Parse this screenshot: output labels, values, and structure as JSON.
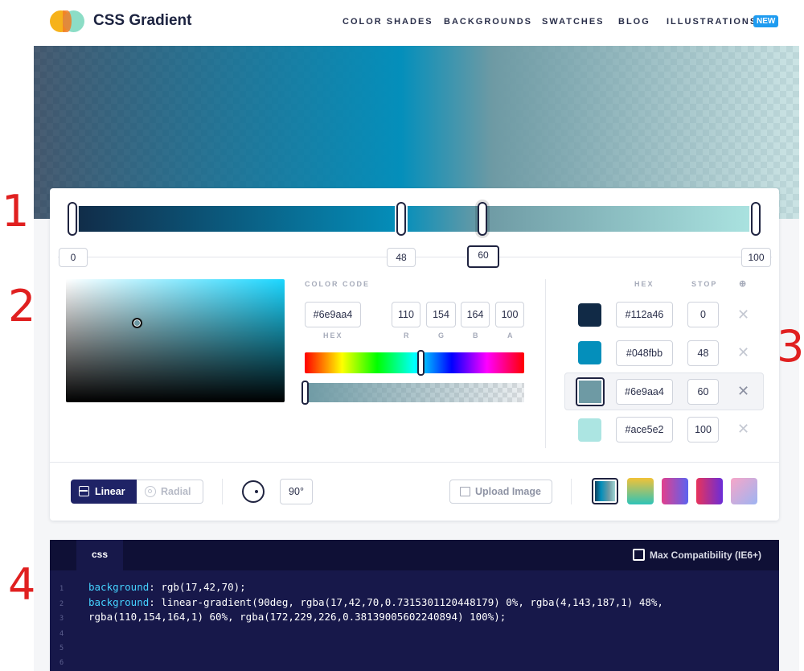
{
  "header": {
    "brand": "CSS Gradient",
    "nav": [
      "COLOR SHADES",
      "BACKGROUNDS",
      "SWATCHES",
      "BLOG",
      "ILLUSTRATIONS"
    ],
    "new_badge": "NEW"
  },
  "gradient_bar": {
    "stop_labels": [
      "0",
      "48",
      "60",
      "100"
    ],
    "active_stop": "60"
  },
  "picker": {
    "color_code_label": "COLOR CODE",
    "hex_value": "#6e9aa4",
    "r": "110",
    "g": "154",
    "b": "164",
    "a": "100",
    "labels": {
      "hex": "HEX",
      "r": "R",
      "g": "G",
      "b": "B",
      "a": "A"
    }
  },
  "stops_list": {
    "hex_header": "HEX",
    "stop_header": "STOP",
    "add_icon": "⊕",
    "rows": [
      {
        "color": "#112a46",
        "hex": "#112a46",
        "stop": "0"
      },
      {
        "color": "#048fbb",
        "hex": "#048fbb",
        "stop": "48"
      },
      {
        "color": "#6e9aa4",
        "hex": "#6e9aa4",
        "stop": "60"
      },
      {
        "color": "#ace5e2",
        "hex": "#ace5e2",
        "stop": "100"
      }
    ],
    "remove_icon": "✕"
  },
  "toolbar": {
    "linear_label": "Linear",
    "radial_label": "Radial",
    "angle_value": "90°",
    "upload_label": "Upload Image"
  },
  "code": {
    "tab": "css",
    "max_compat_label": "Max Compatibility (IE6+)",
    "line_numbers": [
      "1",
      "2",
      "3",
      "4",
      "5",
      "6"
    ],
    "line1_prop": "background",
    "line1_value": ": rgb(17,42,70);",
    "line2_prop": "background",
    "line2_value": ": linear-gradient(90deg, rgba(17,42,70,0.7315301120448179) 0%, rgba(4,143,187,1) 48%,",
    "line3_value": "rgba(110,154,164,1) 60%, rgba(172,229,226,0.38139005602240894) 100%);"
  },
  "annotations": [
    "1",
    "2",
    "3",
    "4"
  ]
}
